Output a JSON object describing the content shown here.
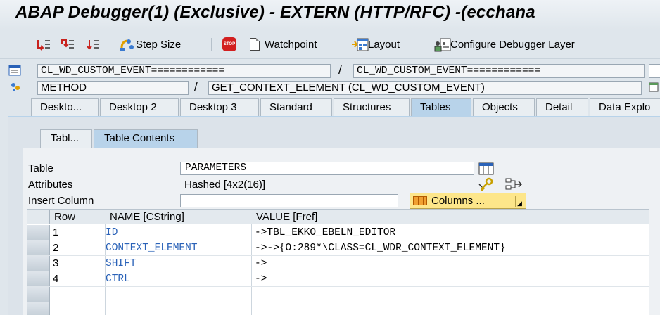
{
  "window": {
    "title": "ABAP Debugger(1)  (Exclusive) - EXTERN (HTTP/RFC) -(ecchana"
  },
  "toolbar": {
    "step_size_label": "Step Size",
    "watchpoint_label": "Watchpoint",
    "layout_label": "Layout",
    "configure_label": "Configure Debugger Layer"
  },
  "header": {
    "program_field": "CL_WD_CUSTOM_EVENT============",
    "include_field": "CL_WD_CUSTOM_EVENT============",
    "event_type_field": "METHOD",
    "event_field": "GET_CONTEXT_ELEMENT (CL_WD_CUSTOM_EVENT)",
    "separator": "/"
  },
  "tabs": [
    {
      "label": "Deskto..."
    },
    {
      "label": "Desktop 2"
    },
    {
      "label": "Desktop 3"
    },
    {
      "label": "Standard"
    },
    {
      "label": "Structures"
    },
    {
      "label": "Tables"
    },
    {
      "label": "Objects"
    },
    {
      "label": "Detail"
    },
    {
      "label": "Data Explo"
    }
  ],
  "subtabs": [
    {
      "label": "Tabl..."
    },
    {
      "label": "Table Contents"
    }
  ],
  "tool": {
    "table_label": "Table",
    "table_value": "PARAMETERS",
    "attributes_label": "Attributes",
    "attributes_value": "Hashed [4x2(16)]",
    "insert_column_label": "Insert Column",
    "insert_column_value": "",
    "columns_button": "Columns ..."
  },
  "grid": {
    "headers": [
      "Row",
      "NAME [CString]",
      "VALUE [Fref]"
    ],
    "rows": [
      {
        "row": "1",
        "name": "ID",
        "value": "->TBL_EKKO_EBELN_EDITOR"
      },
      {
        "row": "2",
        "name": "CONTEXT_ELEMENT",
        "value": "->->{O:289*\\CLASS=CL_WDR_CONTEXT_ELEMENT}"
      },
      {
        "row": "3",
        "name": "SHIFT",
        "value": "->"
      },
      {
        "row": "4",
        "name": "CTRL",
        "value": "->"
      }
    ]
  },
  "colors": {
    "active_tab": "#b8d3ea",
    "name_text": "#2a62b8",
    "columns_button": "#fde68a"
  }
}
